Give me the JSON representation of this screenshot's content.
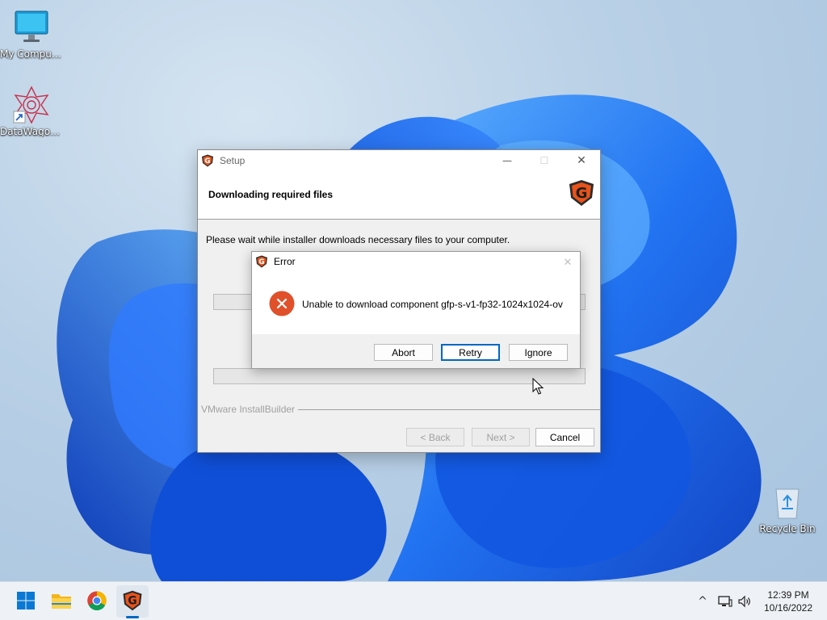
{
  "desktop": {
    "icons": [
      {
        "label": "My Computer",
        "icon": "monitor-icon"
      },
      {
        "label": "DataWagon...",
        "icon": "datawagon-icon"
      },
      {
        "label": "Recycle Bin",
        "icon": "recycle-bin-icon"
      }
    ]
  },
  "setup": {
    "title": "Setup",
    "heading": "Downloading required files",
    "wait_text": "Please wait while installer downloads necessary files to your computer.",
    "brand": "VMware InstallBuilder",
    "buttons": {
      "back": "< Back",
      "next": "Next >",
      "cancel": "Cancel"
    },
    "controls": {
      "minimize": "—",
      "maximize": "☐",
      "close": "✕"
    }
  },
  "error_dialog": {
    "title": "Error",
    "message": "Unable to download component gfp-s-v1-fp32-1024x1024-ov",
    "buttons": {
      "abort": "Abort",
      "retry": "Retry",
      "ignore": "Ignore"
    },
    "close": "✕"
  },
  "taskbar": {
    "apps": [
      {
        "name": "Start",
        "icon": "windows-start-icon"
      },
      {
        "name": "File Explorer",
        "icon": "folder-icon"
      },
      {
        "name": "Google Chrome",
        "icon": "chrome-icon"
      },
      {
        "name": "Setup",
        "icon": "app-g-icon",
        "active": true
      }
    ],
    "tray": {
      "chevron": "^",
      "time": "12:39 PM",
      "date": "10/16/2022"
    }
  },
  "colors": {
    "accent": "#0067c0",
    "error_red": "#e4572e",
    "app_brand": "#e8531a"
  }
}
